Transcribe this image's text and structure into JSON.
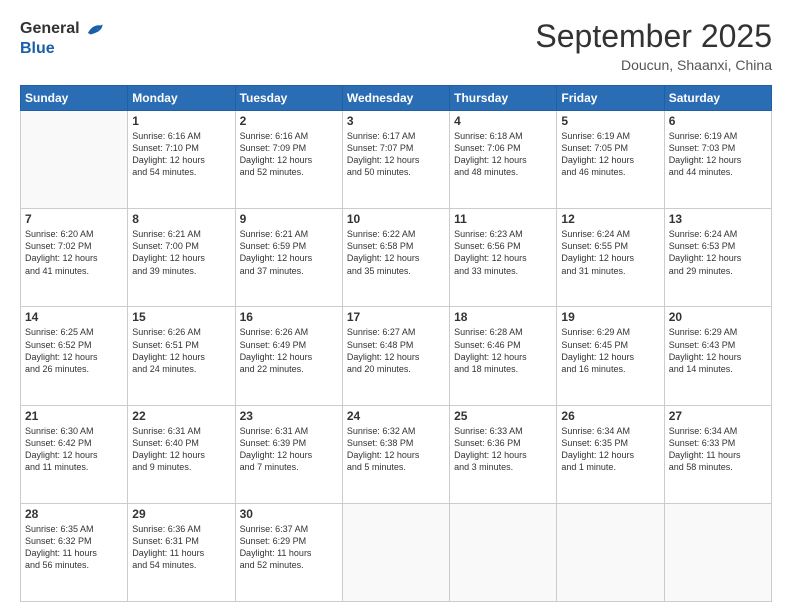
{
  "header": {
    "logo_general": "General",
    "logo_blue": "Blue",
    "month_title": "September 2025",
    "location": "Doucun, Shaanxi, China"
  },
  "days_of_week": [
    "Sunday",
    "Monday",
    "Tuesday",
    "Wednesday",
    "Thursday",
    "Friday",
    "Saturday"
  ],
  "weeks": [
    [
      {
        "day": null,
        "info": null
      },
      {
        "day": "1",
        "info": "Sunrise: 6:16 AM\nSunset: 7:10 PM\nDaylight: 12 hours\nand 54 minutes."
      },
      {
        "day": "2",
        "info": "Sunrise: 6:16 AM\nSunset: 7:09 PM\nDaylight: 12 hours\nand 52 minutes."
      },
      {
        "day": "3",
        "info": "Sunrise: 6:17 AM\nSunset: 7:07 PM\nDaylight: 12 hours\nand 50 minutes."
      },
      {
        "day": "4",
        "info": "Sunrise: 6:18 AM\nSunset: 7:06 PM\nDaylight: 12 hours\nand 48 minutes."
      },
      {
        "day": "5",
        "info": "Sunrise: 6:19 AM\nSunset: 7:05 PM\nDaylight: 12 hours\nand 46 minutes."
      },
      {
        "day": "6",
        "info": "Sunrise: 6:19 AM\nSunset: 7:03 PM\nDaylight: 12 hours\nand 44 minutes."
      }
    ],
    [
      {
        "day": "7",
        "info": "Sunrise: 6:20 AM\nSunset: 7:02 PM\nDaylight: 12 hours\nand 41 minutes."
      },
      {
        "day": "8",
        "info": "Sunrise: 6:21 AM\nSunset: 7:00 PM\nDaylight: 12 hours\nand 39 minutes."
      },
      {
        "day": "9",
        "info": "Sunrise: 6:21 AM\nSunset: 6:59 PM\nDaylight: 12 hours\nand 37 minutes."
      },
      {
        "day": "10",
        "info": "Sunrise: 6:22 AM\nSunset: 6:58 PM\nDaylight: 12 hours\nand 35 minutes."
      },
      {
        "day": "11",
        "info": "Sunrise: 6:23 AM\nSunset: 6:56 PM\nDaylight: 12 hours\nand 33 minutes."
      },
      {
        "day": "12",
        "info": "Sunrise: 6:24 AM\nSunset: 6:55 PM\nDaylight: 12 hours\nand 31 minutes."
      },
      {
        "day": "13",
        "info": "Sunrise: 6:24 AM\nSunset: 6:53 PM\nDaylight: 12 hours\nand 29 minutes."
      }
    ],
    [
      {
        "day": "14",
        "info": "Sunrise: 6:25 AM\nSunset: 6:52 PM\nDaylight: 12 hours\nand 26 minutes."
      },
      {
        "day": "15",
        "info": "Sunrise: 6:26 AM\nSunset: 6:51 PM\nDaylight: 12 hours\nand 24 minutes."
      },
      {
        "day": "16",
        "info": "Sunrise: 6:26 AM\nSunset: 6:49 PM\nDaylight: 12 hours\nand 22 minutes."
      },
      {
        "day": "17",
        "info": "Sunrise: 6:27 AM\nSunset: 6:48 PM\nDaylight: 12 hours\nand 20 minutes."
      },
      {
        "day": "18",
        "info": "Sunrise: 6:28 AM\nSunset: 6:46 PM\nDaylight: 12 hours\nand 18 minutes."
      },
      {
        "day": "19",
        "info": "Sunrise: 6:29 AM\nSunset: 6:45 PM\nDaylight: 12 hours\nand 16 minutes."
      },
      {
        "day": "20",
        "info": "Sunrise: 6:29 AM\nSunset: 6:43 PM\nDaylight: 12 hours\nand 14 minutes."
      }
    ],
    [
      {
        "day": "21",
        "info": "Sunrise: 6:30 AM\nSunset: 6:42 PM\nDaylight: 12 hours\nand 11 minutes."
      },
      {
        "day": "22",
        "info": "Sunrise: 6:31 AM\nSunset: 6:40 PM\nDaylight: 12 hours\nand 9 minutes."
      },
      {
        "day": "23",
        "info": "Sunrise: 6:31 AM\nSunset: 6:39 PM\nDaylight: 12 hours\nand 7 minutes."
      },
      {
        "day": "24",
        "info": "Sunrise: 6:32 AM\nSunset: 6:38 PM\nDaylight: 12 hours\nand 5 minutes."
      },
      {
        "day": "25",
        "info": "Sunrise: 6:33 AM\nSunset: 6:36 PM\nDaylight: 12 hours\nand 3 minutes."
      },
      {
        "day": "26",
        "info": "Sunrise: 6:34 AM\nSunset: 6:35 PM\nDaylight: 12 hours\nand 1 minute."
      },
      {
        "day": "27",
        "info": "Sunrise: 6:34 AM\nSunset: 6:33 PM\nDaylight: 11 hours\nand 58 minutes."
      }
    ],
    [
      {
        "day": "28",
        "info": "Sunrise: 6:35 AM\nSunset: 6:32 PM\nDaylight: 11 hours\nand 56 minutes."
      },
      {
        "day": "29",
        "info": "Sunrise: 6:36 AM\nSunset: 6:31 PM\nDaylight: 11 hours\nand 54 minutes."
      },
      {
        "day": "30",
        "info": "Sunrise: 6:37 AM\nSunset: 6:29 PM\nDaylight: 11 hours\nand 52 minutes."
      },
      {
        "day": null,
        "info": null
      },
      {
        "day": null,
        "info": null
      },
      {
        "day": null,
        "info": null
      },
      {
        "day": null,
        "info": null
      }
    ]
  ]
}
